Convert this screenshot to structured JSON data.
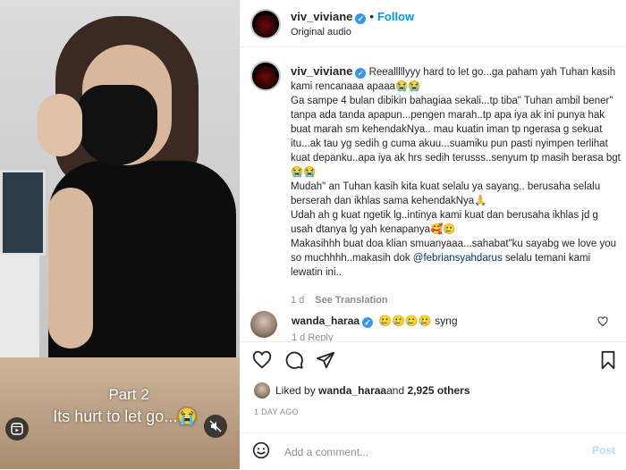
{
  "media": {
    "caption_line1": "Part 2",
    "caption_line2": "Its hurt to let go...😭",
    "reel_icon": "reels-icon",
    "mute_icon": "speaker-muted-icon"
  },
  "header": {
    "username": "viv_viviane",
    "separator": "•",
    "follow_label": "Follow",
    "audio_label": "Original audio"
  },
  "caption": {
    "username": "viv_viviane",
    "text_before_mention": "Reealllllyyy hard to let go...ga paham yah Tuhan kasih kami rencanaaa apaaa😭😭\nGa sampe 4 bulan dibikin bahagiaa sekali...tp tiba\" Tuhan ambil bener\" tanpa ada tanda apapun...pengen marah..tp apa iya ak ini punya hak buat marah sm kehendakNya.. mau kuatin iman tp ngerasa g sekuat itu...ak tau yg sedih g cuma akuu...suamiku pun pasti nyimpen terlihat kuat depanku..apa iya ak hrs sedih terusss..senyum tp masih berasa bgt 😭😭\nMudah\" an Tuhan kasih kita kuat selalu ya sayang.. berusaha selalu berserah dan ikhlas sama kehendakNya🙏\nUdah ah g kuat ngetik lg..intinya kami kuat dan berusaha ikhlas jd g usah dtanya lg yah kenapanya🥰🥲\nMakasihhh buat doa klian smuanyaaa...sahabat\"ku sayabg we love you so muchhhh..makasih dok ",
    "mention": "@febriansyahdarus",
    "text_after_mention": " selalu temani kami lewatin ini..",
    "time": "1 d",
    "see_translation": "See Translation"
  },
  "comment": {
    "username": "wanda_haraa",
    "text": "🥲🥲🥲🥲 syng",
    "time_partial": "1 d   Reply"
  },
  "actions": {
    "like_icon": "heart-icon",
    "comment_icon": "comment-icon",
    "share_icon": "share-icon",
    "save_icon": "bookmark-icon"
  },
  "likes": {
    "prefix": "Liked by ",
    "user": "wanda_haraa",
    "middle": " and ",
    "count": "2,925 others"
  },
  "date": "1 DAY AGO",
  "add_comment": {
    "placeholder": "Add a comment...",
    "post_label": "Post"
  },
  "colors": {
    "accent": "#0095f6",
    "verified": "#3797f0",
    "post_disabled": "#b2dffc",
    "muted_text": "#8e8e8e"
  }
}
